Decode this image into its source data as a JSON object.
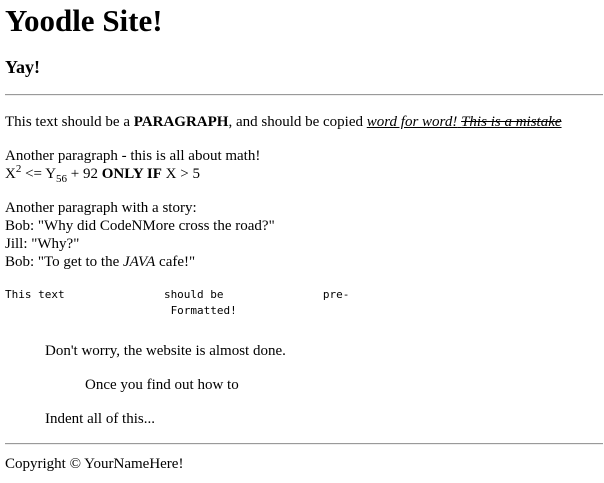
{
  "site_title": "Yoodle Site!",
  "subtitle": "Yay!",
  "paragraph1": {
    "text_before": "This text should be a ",
    "bold": "PARAGRAPH",
    "text_middle": ", and should be copied ",
    "underlined_italic": "word for word!",
    "space": " ",
    "strikethrough_italic": "This is a mistake"
  },
  "math": {
    "intro": "Another paragraph - this is all about math!",
    "x_base": "X",
    "x_sup": "2",
    "le_text": " <= Y",
    "y_sub": "56",
    "plus_text": " + 92 ",
    "only_if": "ONLY IF",
    "tail": " X > 5"
  },
  "story": {
    "intro": "Another paragraph with a story:",
    "line1": "Bob: \"Why did CodeNMore cross the road?\"",
    "line2": "Jill: \"Why?\"",
    "line3_before": "Bob: \"To get to the ",
    "line3_italic": "JAVA",
    "line3_after": " cafe!\""
  },
  "preformatted": "This text               should be               pre-\n                         Formatted!",
  "indented": {
    "line1": "Don't worry, the website is almost done.",
    "line2": "Once you find out how to",
    "line3": "Indent all of this..."
  },
  "footer": "Copyright © YourNameHere!"
}
